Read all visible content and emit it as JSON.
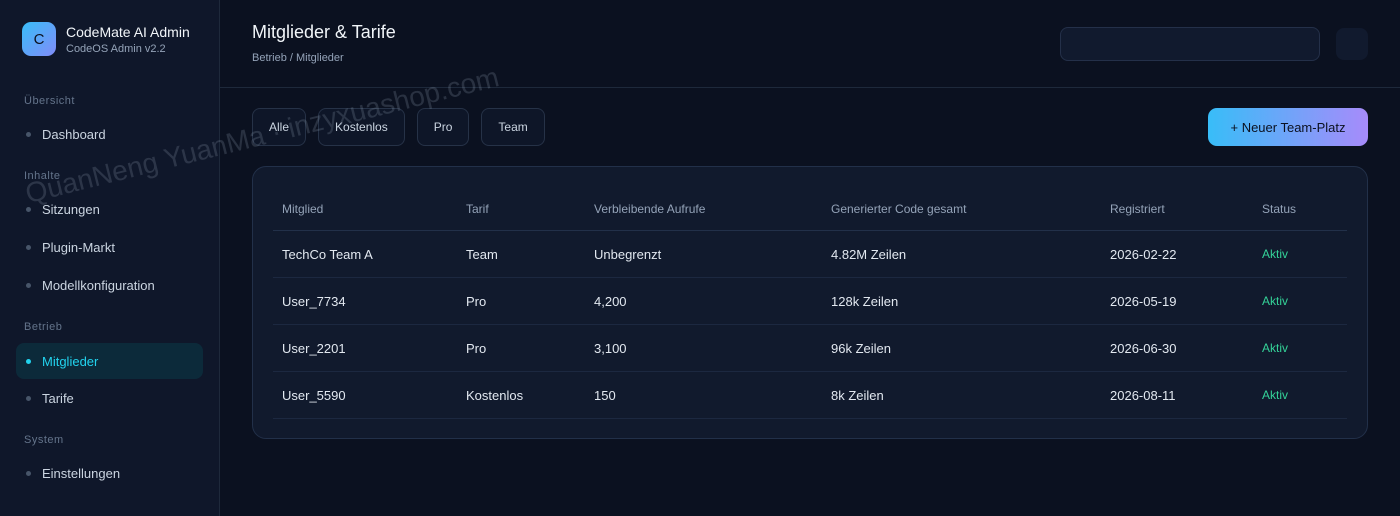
{
  "brand": {
    "logo_letter": "C",
    "name": "CodeMate AI Admin",
    "version": "CodeOS Admin v2.2"
  },
  "sidebar": {
    "sections": [
      {
        "label": "Übersicht",
        "items": [
          {
            "label": "Dashboard",
            "active": false
          }
        ]
      },
      {
        "label": "Inhalte",
        "items": [
          {
            "label": "Sitzungen",
            "active": false
          },
          {
            "label": "Plugin-Markt",
            "active": false
          },
          {
            "label": "Modellkonfiguration",
            "active": false
          }
        ]
      },
      {
        "label": "Betrieb",
        "items": [
          {
            "label": "Mitglieder",
            "active": true
          },
          {
            "label": "Tarife",
            "active": false
          }
        ]
      },
      {
        "label": "System",
        "items": [
          {
            "label": "Einstellungen",
            "active": false
          }
        ]
      }
    ]
  },
  "header": {
    "title": "Mitglieder & Tarife",
    "breadcrumb": "Betrieb / Mitglieder",
    "search_value": ""
  },
  "filters": [
    "Alle",
    "Kostenlos",
    "Pro",
    "Team"
  ],
  "primary_action": "+ Neuer Team-Platz",
  "table": {
    "columns": [
      "Mitglied",
      "Tarif",
      "Verbleibende Aufrufe",
      "Generierter Code gesamt",
      "Registriert",
      "Status"
    ],
    "rows": [
      [
        "TechCo Team A",
        "Team",
        "Unbegrenzt",
        "4.82M Zeilen",
        "2026-02-22",
        "Aktiv"
      ],
      [
        "User_7734",
        "Pro",
        "4,200",
        "128k Zeilen",
        "2026-05-19",
        "Aktiv"
      ],
      [
        "User_2201",
        "Pro",
        "3,100",
        "96k Zeilen",
        "2026-06-30",
        "Aktiv"
      ],
      [
        "User_5590",
        "Kostenlos",
        "150",
        "8k Zeilen",
        "2026-08-11",
        "Aktiv"
      ]
    ]
  },
  "watermark": "QuanNeng YuanMa · inzyxuashop.com",
  "colors": {
    "accent": "#22d3ee",
    "status_active": "#34d399",
    "background": "#0b1120",
    "sidebar": "#0f172a"
  }
}
